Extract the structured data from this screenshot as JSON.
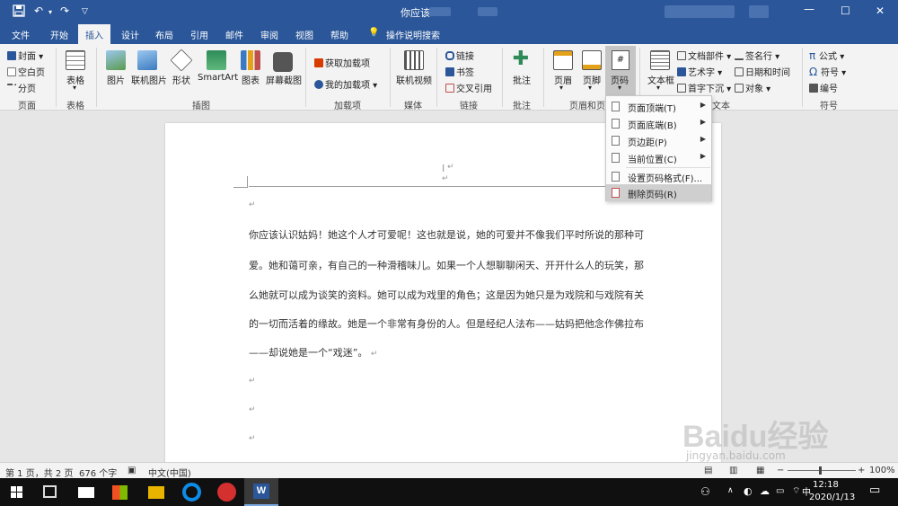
{
  "title_bar": {
    "doc_title": "你应该"
  },
  "tabs": [
    "文件",
    "开始",
    "插入",
    "设计",
    "布局",
    "引用",
    "邮件",
    "审阅",
    "视图",
    "帮助",
    "操作说明搜索"
  ],
  "ribbon": {
    "pages": {
      "cover": "封面",
      "blank": "空白页",
      "break": "分页",
      "label": "页面"
    },
    "tables": {
      "table": "表格",
      "label": "表格"
    },
    "illustrations": {
      "picture": "图片",
      "online_picture": "联机图片",
      "shapes": "形状",
      "smartart": "SmartArt",
      "chart": "图表",
      "screenshot": "屏幕截图",
      "label": "插图"
    },
    "addins": {
      "get": "获取加载项",
      "my": "我的加载项",
      "label": "加载项"
    },
    "media": {
      "online_video": "联机视频",
      "label": "媒体"
    },
    "links": {
      "link": "链接",
      "bookmark": "书签",
      "cross_ref": "交叉引用",
      "label": "链接"
    },
    "comments": {
      "comment": "批注",
      "label": "批注"
    },
    "header_footer": {
      "header": "页眉",
      "footer": "页脚",
      "page_number": "页码",
      "label": "页眉和页"
    },
    "text": {
      "textbox": "文本框",
      "quick_parts": "文档部件",
      "wordart": "艺术字",
      "dropcap": "首字下沉",
      "signature": "签名行",
      "datetime": "日期和时间",
      "object": "对象",
      "label": "文本"
    },
    "symbols": {
      "equation": "公式",
      "symbol": "符号",
      "number": "编号",
      "label": "符号"
    }
  },
  "dropdown": {
    "items": [
      "页面顶端(T)",
      "页面底端(B)",
      "页边距(P)",
      "当前位置(C)",
      "设置页码格式(F)...",
      "删除页码(R)"
    ]
  },
  "document": {
    "paragraphs": [
      "你应该认识姑妈！她这个人才可爱呢！这也就是说，她的可爱并不像我们平时所说的那种可",
      "爱。她和蔼可亲，有自己的一种滑稽味儿。如果一个人想聊聊闲天、开开什么人的玩笑，那",
      "么她就可以成为谈笑的资料。她可以成为戏里的角色；这是因为她只是为戏院和与戏院有关",
      "的一切而活着的缘故。她是一个非常有身份的人。但是经纪人法布——姑妈把他念作佛拉布",
      "——却说她是一个“戏迷”。"
    ],
    "para_mark": "↵",
    "cursor": "I"
  },
  "status_bar": {
    "page": "第 1 页，共 2 页",
    "words": "676 个字",
    "language": "中文(中国)",
    "zoom": "100%"
  },
  "taskbar": {
    "time": "12:18",
    "date": "2020/1/13",
    "ime": "中"
  },
  "watermark": {
    "text": "Baidu经验",
    "url": "jingyan.baidu.com"
  }
}
